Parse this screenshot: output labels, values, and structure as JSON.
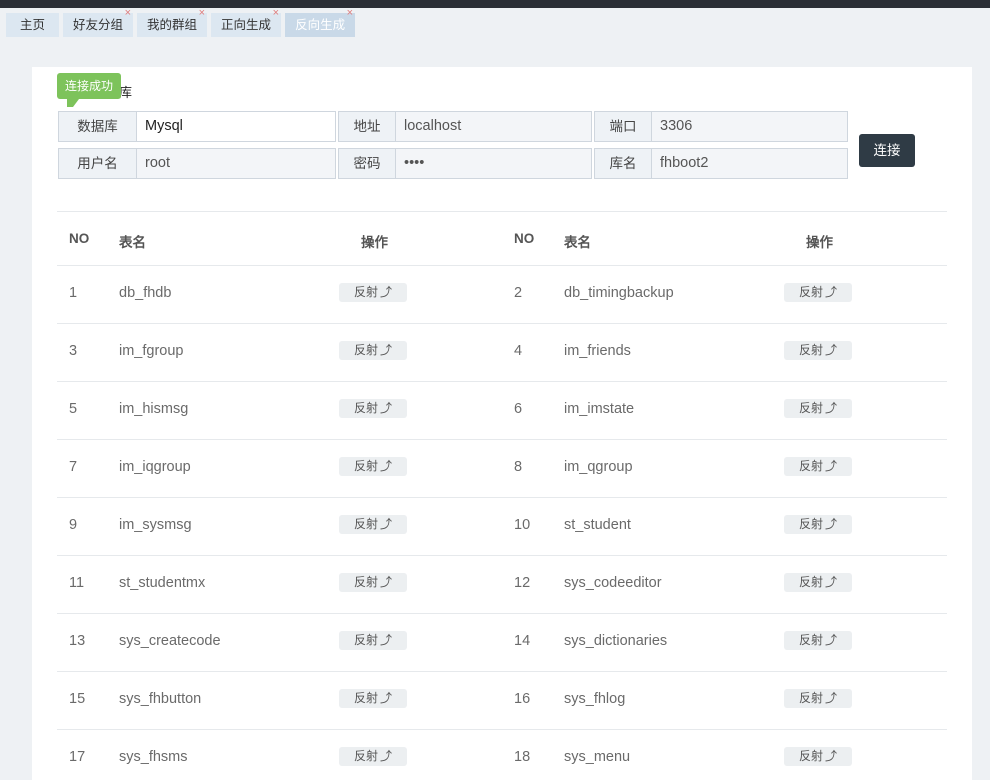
{
  "tabs": [
    {
      "label": "主页",
      "closable": false,
      "active": false
    },
    {
      "label": "好友分组",
      "closable": true,
      "active": false
    },
    {
      "label": "我的群组",
      "closable": true,
      "active": false
    },
    {
      "label": "正向生成",
      "closable": true,
      "active": false
    },
    {
      "label": "反向生成",
      "closable": true,
      "active": true
    }
  ],
  "close_glyph": "×",
  "tooltip": "连接成功",
  "section_title_visible": "库",
  "form": {
    "db_label": "数据库",
    "db_value": "Mysql",
    "addr_label": "地址",
    "addr_value": "localhost",
    "port_label": "端口",
    "port_value": "3306",
    "user_label": "用户名",
    "user_value": "root",
    "pwd_label": "密码",
    "pwd_value": "••••",
    "dbname_label": "库名",
    "dbname_value": "fhboot2"
  },
  "connect_label": "连接",
  "table": {
    "headers": {
      "no": "NO",
      "name": "表名",
      "op": "操作"
    },
    "action_label": "反射",
    "action_icon": "reflect-icon",
    "rows": [
      [
        {
          "no": "1",
          "name": "db_fhdb"
        },
        {
          "no": "2",
          "name": "db_timingbackup"
        }
      ],
      [
        {
          "no": "3",
          "name": "im_fgroup"
        },
        {
          "no": "4",
          "name": "im_friends"
        }
      ],
      [
        {
          "no": "5",
          "name": "im_hismsg"
        },
        {
          "no": "6",
          "name": "im_imstate"
        }
      ],
      [
        {
          "no": "7",
          "name": "im_iqgroup"
        },
        {
          "no": "8",
          "name": "im_qgroup"
        }
      ],
      [
        {
          "no": "9",
          "name": "im_sysmsg"
        },
        {
          "no": "10",
          "name": "st_student"
        }
      ],
      [
        {
          "no": "11",
          "name": "st_studentmx"
        },
        {
          "no": "12",
          "name": "sys_codeeditor"
        }
      ],
      [
        {
          "no": "13",
          "name": "sys_createcode"
        },
        {
          "no": "14",
          "name": "sys_dictionaries"
        }
      ],
      [
        {
          "no": "15",
          "name": "sys_fhbutton"
        },
        {
          "no": "16",
          "name": "sys_fhlog"
        }
      ],
      [
        {
          "no": "17",
          "name": "sys_fhsms"
        },
        {
          "no": "18",
          "name": "sys_menu"
        }
      ]
    ]
  }
}
